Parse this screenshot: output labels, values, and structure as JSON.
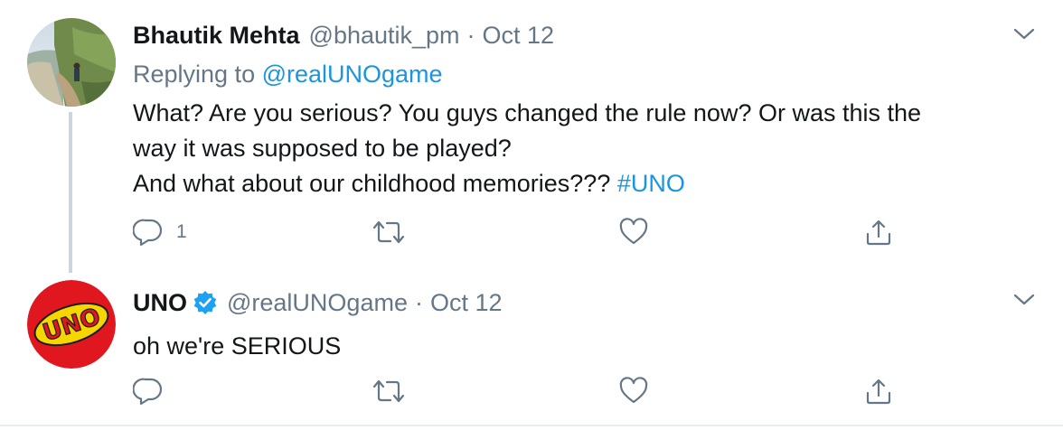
{
  "tweets": [
    {
      "author_name": "Bhautik Mehta",
      "handle": "@bhautik_pm",
      "separator": "·",
      "date": "Oct 12",
      "replying_prefix": "Replying to ",
      "replying_handle": "@realUNOgame",
      "text_line1": "What? Are you serious? You guys changed the rule now? Or was this the",
      "text_line2": "way it was supposed to be played?",
      "text_line3": "And what about our childhood memories??? ",
      "hashtag": "#UNO",
      "reply_count": "1",
      "avatar_icon": "landscape-photo-avatar"
    },
    {
      "author_name": "UNO",
      "verified": true,
      "handle": "@realUNOgame",
      "separator": "·",
      "date": "Oct 12",
      "text": "oh we're SERIOUS",
      "reply_count": "",
      "avatar_icon": "uno-logo-avatar",
      "avatar_logo_text": "UNO"
    }
  ],
  "icons": {
    "reply": "reply-icon",
    "retweet": "retweet-icon",
    "like": "heart-icon",
    "share": "share-icon",
    "more": "chevron-down-icon",
    "verified": "verified-badge-icon"
  },
  "colors": {
    "link": "#1b95e0",
    "secondary_text": "#657786",
    "primary_text": "#14171a",
    "thread_line": "#ccd6dd",
    "verified": "#1da1f2",
    "uno_red": "#e0171f",
    "uno_yellow": "#f5d600"
  }
}
